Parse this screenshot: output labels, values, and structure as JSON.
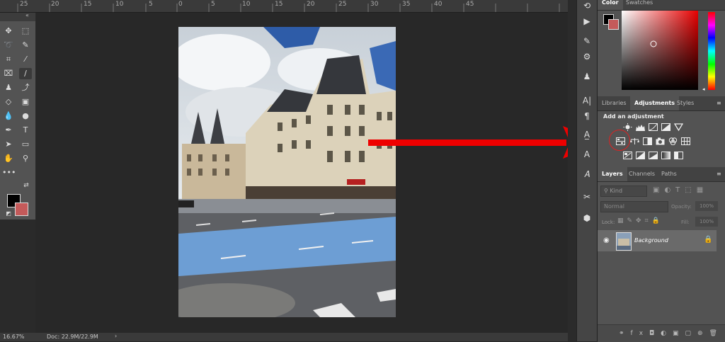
{
  "ruler": {
    "labels": [
      "25",
      "20",
      "15",
      "10",
      "5",
      "0",
      "5",
      "10",
      "15",
      "20",
      "25",
      "30",
      "35",
      "40",
      "45"
    ]
  },
  "status": {
    "zoom": "16.67%",
    "doc": "Doc: 22.9M/22.9M",
    "arrow": "›"
  },
  "panels": {
    "color": {
      "tab1": "Color",
      "tab2": "Swatches"
    },
    "adjustments_group": {
      "tab1": "Libraries",
      "tab2": "Adjustments",
      "tab3": "Styles",
      "heading": "Add an adjustment"
    },
    "layers_group": {
      "tab1": "Layers",
      "tab2": "Channels",
      "tab3": "Paths",
      "kind": "Kind",
      "blend": "Normal",
      "opacity_label": "Opacity:",
      "opacity_value": "100%",
      "lock_label": "Lock:",
      "fill_label": "Fill:",
      "fill_value": "100%",
      "layer_name": "Background"
    }
  },
  "colors": {
    "accent_arrow": "#ee0000",
    "panel": "#535353",
    "foreground": "#000000",
    "background": "#c45a5a"
  }
}
